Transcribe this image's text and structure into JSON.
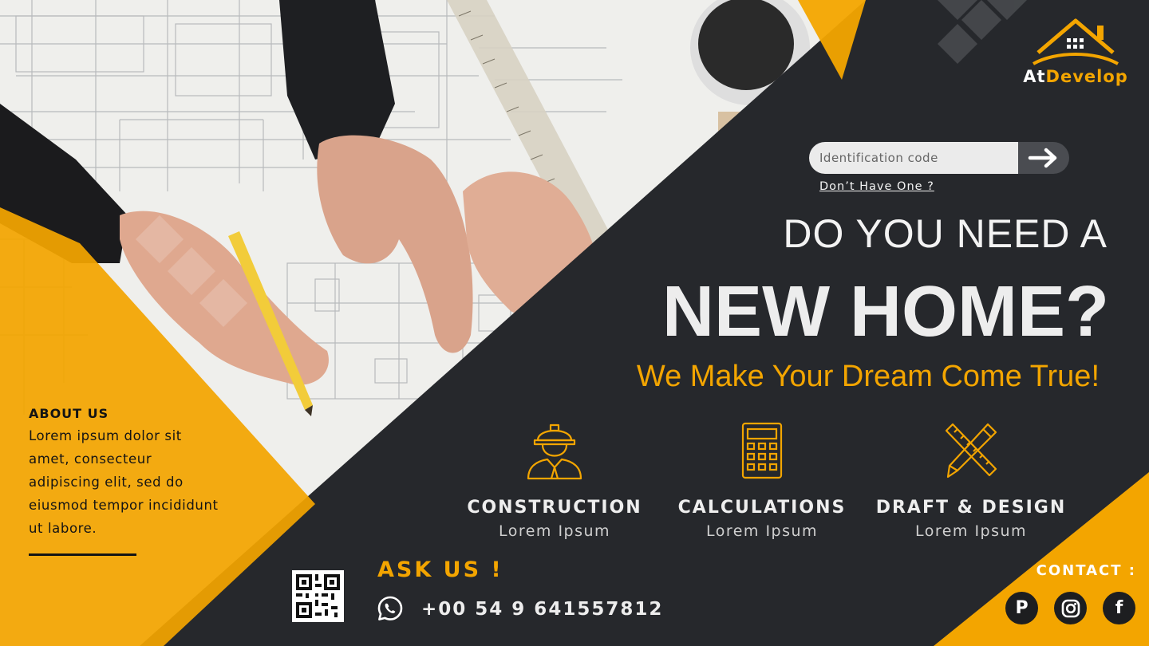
{
  "brand": {
    "name_prefix": "At",
    "name_suffix": "Develop"
  },
  "login": {
    "placeholder": "Identification code",
    "no_account_link": "Don’t Have One ?"
  },
  "hero": {
    "line1": "DO YOU NEED A",
    "line2": "NEW HOME?",
    "tagline": "We Make Your Dream Come True!"
  },
  "services": [
    {
      "icon": "worker-helmet-icon",
      "title": "CONSTRUCTION",
      "subtitle": "Lorem Ipsum"
    },
    {
      "icon": "calculator-icon",
      "title": "CALCULATIONS",
      "subtitle": "Lorem Ipsum"
    },
    {
      "icon": "pencil-ruler-icon",
      "title": "DRAFT & DESIGN",
      "subtitle": "Lorem Ipsum"
    }
  ],
  "about": {
    "title": "ABOUT US",
    "text": "Lorem ipsum dolor sit amet, consecteur adipiscing elit, sed do eiusmod tempor incididunt ut labore."
  },
  "ask": {
    "label": "ASK US !",
    "phone": "+00 54 9 641557812",
    "icon": "whatsapp-icon"
  },
  "contact": {
    "label": "CONTACT :",
    "socials": [
      {
        "icon": "pinterest-icon",
        "glyph": "P"
      },
      {
        "icon": "instagram-icon",
        "glyph": ""
      },
      {
        "icon": "facebook-icon",
        "glyph": "f"
      }
    ]
  },
  "colors": {
    "accent": "#f3a500",
    "dark": "#26282c",
    "light": "#ededed"
  }
}
